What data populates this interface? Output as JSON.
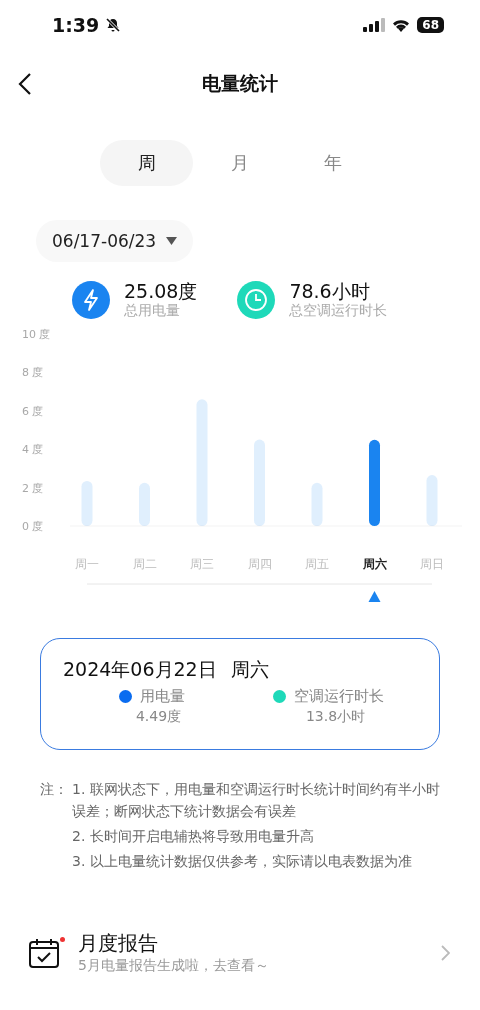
{
  "status_bar": {
    "time": "1:39",
    "battery": "68"
  },
  "header": {
    "title": "电量统计"
  },
  "tabs": [
    {
      "label": "周",
      "selected": true
    },
    {
      "label": "月",
      "selected": false
    },
    {
      "label": "年",
      "selected": false
    }
  ],
  "date_range": {
    "value": "06/17-06/23"
  },
  "summary": [
    {
      "kind": "energy",
      "value": "25.08度",
      "label": "总用电量"
    },
    {
      "kind": "runtime",
      "value": "78.6小时",
      "label": "总空调运行时长"
    }
  ],
  "chart": {
    "chart_data": {
      "type": "bar",
      "categories": [
        "周一",
        "周二",
        "周三",
        "周四",
        "周五",
        "周六",
        "周日"
      ],
      "series": [
        {
          "color": "#1a84f0",
          "values": [
            2.35,
            2.25,
            6.6,
            4.5,
            2.25,
            4.49,
            2.65
          ]
        }
      ],
      "ylim": [
        0,
        10
      ],
      "yticks": [
        {
          "value": 0,
          "label": "0 度"
        },
        {
          "value": 2,
          "label": "2 度"
        },
        {
          "value": 4,
          "label": "4 度"
        },
        {
          "value": 6,
          "label": "6 度"
        },
        {
          "value": 8,
          "label": "8 度"
        },
        {
          "value": 10,
          "label": "10 度"
        }
      ]
    },
    "days": [
      {
        "selected": false
      },
      {
        "selected": false
      },
      {
        "selected": false
      },
      {
        "selected": false
      },
      {
        "selected": false
      },
      {
        "selected": true
      },
      {
        "selected": false
      }
    ]
  },
  "detail": {
    "date": "2024年06月22日",
    "weekday": "周六",
    "metrics": [
      {
        "label": "用电量",
        "value": "4.49度",
        "color": "#0a6cf0"
      },
      {
        "label": "空调运行时长",
        "value": "13.8小时",
        "color": "#1ed9b9"
      }
    ]
  },
  "notes": {
    "prefix": "注：",
    "items": [
      "1. 联网状态下，用电量和空调运行时长统计时间约有半小时误差；断网状态下统计数据会有误差",
      "2. 长时间开启电辅热将导致用电量升高",
      "3. 以上电量统计数据仅供参考，实际请以电表数据为准"
    ]
  },
  "report": {
    "title": "月度报告",
    "subtitle": "5月电量报告生成啦，去查看～",
    "unread": true
  }
}
